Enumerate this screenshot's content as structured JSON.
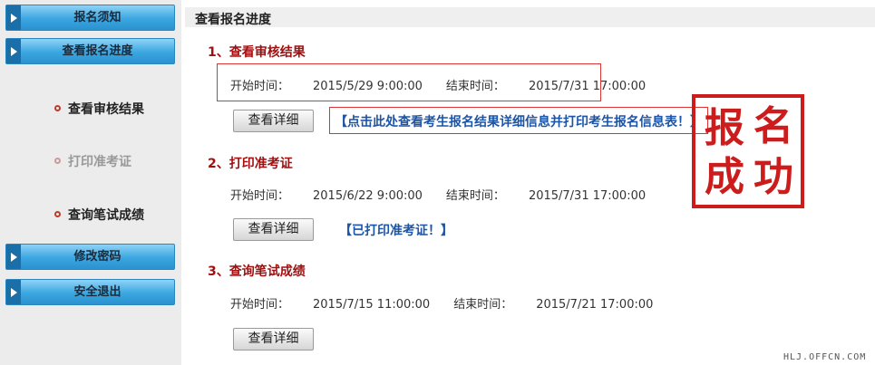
{
  "sidebar": {
    "nav": [
      {
        "label": "报名须知"
      },
      {
        "label": "查看报名进度"
      },
      {
        "label": "修改密码"
      },
      {
        "label": "安全退出"
      }
    ],
    "sub_items": [
      {
        "label": "查看审核结果"
      },
      {
        "label": "打印准考证"
      },
      {
        "label": "查询笔试成绩"
      }
    ]
  },
  "main": {
    "title": "查看报名进度",
    "sections": [
      {
        "title": "1、查看审核结果",
        "start_label": "开始时间：",
        "start": "2015/5/29 9:00:00",
        "end_label": "结束时间：",
        "end": "2015/7/31 17:00:00",
        "button": "查看详细",
        "link": "【点击此处查看考生报名结果详细信息并打印考生报名信息表！】"
      },
      {
        "title": "2、打印准考证",
        "start_label": "开始时间：",
        "start": "2015/6/22 9:00:00",
        "end_label": "结束时间：",
        "end": "2015/7/31 17:00:00",
        "button": "查看详细",
        "link": "【已打印准考证！】"
      },
      {
        "title": "3、查询笔试成绩",
        "start_label": "开始时间：",
        "start": "2015/7/15 11:00:00",
        "end_label": "结束时间：",
        "end": "2015/7/21 17:00:00",
        "button": "查看详细"
      }
    ]
  },
  "stamp": {
    "text": [
      "报",
      "名",
      "成",
      "功"
    ],
    "color": "#cc1c1c"
  },
  "watermark": "HLJ.OFFCN.COM"
}
